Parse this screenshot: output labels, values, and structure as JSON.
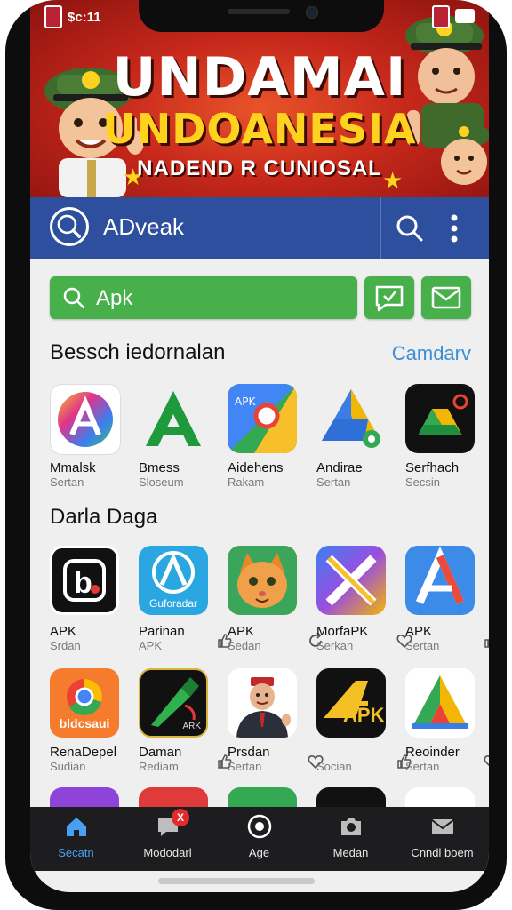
{
  "status_bar": {
    "time": "$c:11"
  },
  "banner": {
    "line1": "UNDAMAI",
    "line2": "UNDOANESIA",
    "line3": "NADEND R CUNIOSAL"
  },
  "app_bar": {
    "title": "ADveak"
  },
  "search": {
    "value": "Apk"
  },
  "section1": {
    "title": "Bessch iedornalan",
    "link": "Camdarv",
    "apps": [
      {
        "name": "Mmalsk",
        "sub": "Sertan"
      },
      {
        "name": "Bmess",
        "sub": "Sloseum"
      },
      {
        "name": "Aidehens",
        "sub": "Rakam"
      },
      {
        "name": "Andirae",
        "sub": "Sertan"
      },
      {
        "name": "Serfhach",
        "sub": "Secsin"
      }
    ]
  },
  "section2": {
    "title": "Darla Daga",
    "apps": [
      {
        "name": "APK",
        "sub": "Srdan",
        "tile_text": ""
      },
      {
        "name": "Parinan",
        "sub": "APK",
        "tile_text": "Guforadar"
      },
      {
        "name": "APK",
        "sub": "Sedan",
        "tile_text": ""
      },
      {
        "name": "MorfaPK",
        "sub": "Serkan",
        "tile_text": ""
      },
      {
        "name": "APK",
        "sub": "Sertan",
        "tile_text": ""
      },
      {
        "name": "RenaDepel",
        "sub": "Sudian",
        "tile_text": "bldcsaui"
      },
      {
        "name": "Daman",
        "sub": "Rediam",
        "tile_text": "ARK"
      },
      {
        "name": "Prsdan",
        "sub": "Sertan",
        "tile_text": ""
      },
      {
        "name": "",
        "sub": "Socian",
        "tile_text": "APK"
      },
      {
        "name": "Reoinder",
        "sub": "Sertan",
        "tile_text": ""
      }
    ]
  },
  "bottom_nav": [
    {
      "label": "Secatn",
      "icon": "home-icon"
    },
    {
      "label": "Mododarl",
      "icon": "chat-icon",
      "badge": "X"
    },
    {
      "label": "Age",
      "icon": "target-icon"
    },
    {
      "label": "Medan",
      "icon": "camera-icon"
    },
    {
      "label": "Cnndl boem",
      "icon": "mail-icon"
    }
  ],
  "colors": {
    "app_bar": "#2e4f9d",
    "search_green": "#47b04a",
    "link_blue": "#3b8fd6",
    "nav_active": "#4aa0f0"
  }
}
